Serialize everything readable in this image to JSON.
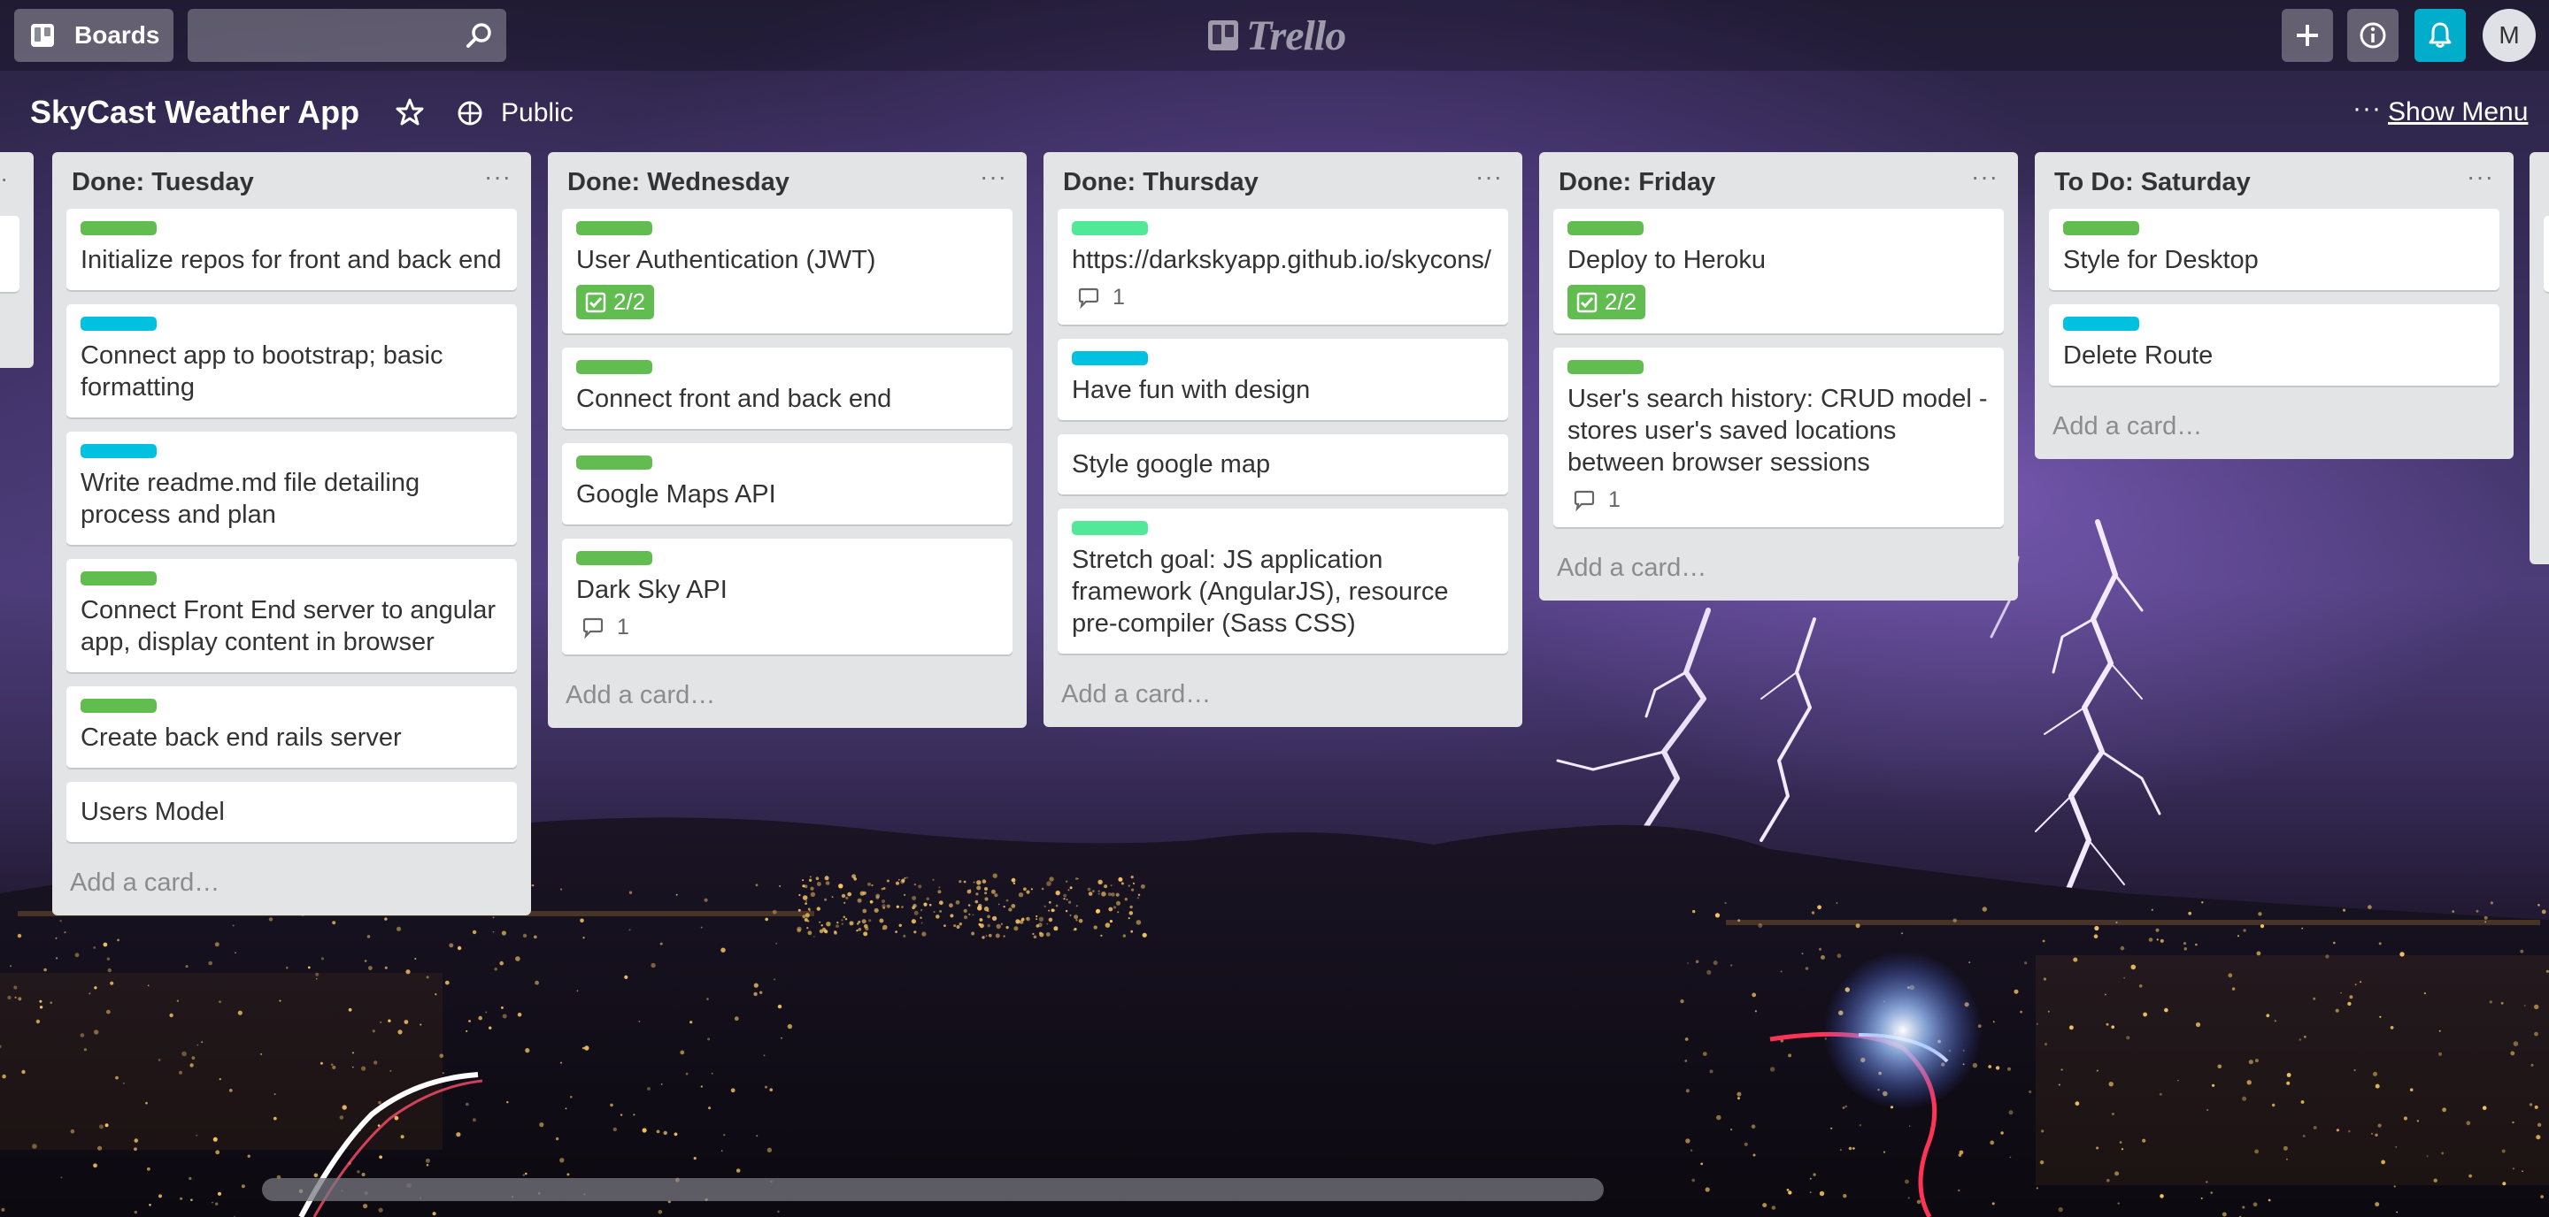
{
  "topbar": {
    "boards_label": "Boards",
    "search_placeholder": "",
    "logo_text": "Trello",
    "avatar_initial": "M"
  },
  "board": {
    "title": "SkyCast Weather App",
    "visibility": "Public",
    "menu_dots": "···",
    "show_menu": "Show Menu"
  },
  "colors": {
    "label_green": "#61bd4f",
    "label_cyan": "#00c2e0",
    "label_mint": "#51e898",
    "notification_bg": "#00aecc"
  },
  "lists": [
    {
      "title": "Done: Tuesday",
      "menu": "···",
      "add_card": "Add a card…",
      "cards": [
        {
          "label": "green",
          "title": "Initialize repos for front and back end"
        },
        {
          "label": "cyan",
          "title": "Connect app to bootstrap; basic formatting"
        },
        {
          "label": "cyan",
          "title": "Write readme.md file detailing process and plan"
        },
        {
          "label": "green",
          "title": "Connect Front End server to angular app, display content in browser"
        },
        {
          "label": "green",
          "title": "Create back end rails server"
        },
        {
          "label": null,
          "title": "Users Model"
        }
      ]
    },
    {
      "title": "Done: Wednesday",
      "menu": "···",
      "add_card": "Add a card…",
      "cards": [
        {
          "label": "green",
          "title": "User Authentication (JWT)",
          "checklist": "2/2"
        },
        {
          "label": "green",
          "title": "Connect front and back end"
        },
        {
          "label": "green",
          "title": "Google Maps API"
        },
        {
          "label": "green",
          "title": "Dark Sky API",
          "comments": "1"
        }
      ]
    },
    {
      "title": "Done: Thursday",
      "menu": "···",
      "add_card": "Add a card…",
      "cards": [
        {
          "label": "mint",
          "title": "https://darkskyapp.github.io/skycons/",
          "comments": "1"
        },
        {
          "label": "cyan",
          "title": "Have fun with design"
        },
        {
          "label": null,
          "title": "Style google map"
        },
        {
          "label": "mint",
          "title": "Stretch goal: JS application framework (AngularJS), resource pre-compiler (Sass CSS)"
        }
      ]
    },
    {
      "title": "Done: Friday",
      "menu": "···",
      "add_card": "Add a card…",
      "cards": [
        {
          "label": "green",
          "title": "Deploy to Heroku",
          "checklist": "2/2"
        },
        {
          "label": "green",
          "title": "User's search history: CRUD model - stores user's saved locations between browser sessions",
          "comments": "1"
        }
      ]
    },
    {
      "title": "To Do: Saturday",
      "menu": "···",
      "add_card": "Add a card…",
      "cards": [
        {
          "label": "green",
          "title": "Style for Desktop"
        },
        {
          "label": "cyan",
          "title": "Delete Route"
        }
      ]
    }
  ]
}
